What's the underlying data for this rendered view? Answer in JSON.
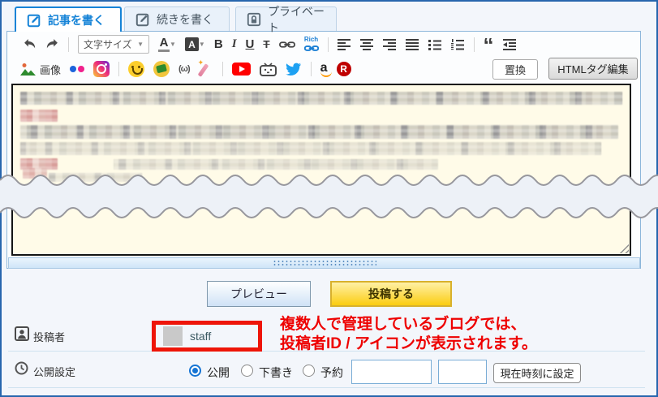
{
  "tabs": [
    {
      "label": "記事を書く",
      "active": true
    },
    {
      "label": "続きを書く",
      "active": false
    },
    {
      "label": "プライベート",
      "active": false
    }
  ],
  "toolbar": {
    "font_size": "文字サイズ",
    "font_color": "A",
    "bg_color": "A",
    "bold": "B",
    "italic": "I",
    "underline": "U",
    "strike": "T",
    "rich": "Rich",
    "quote": "“",
    "image": "画像",
    "kaomoji": "(ω)",
    "amazon": "a",
    "rakuten": "R",
    "replace": "置換",
    "html_edit": "HTMLタグ編集"
  },
  "actions": {
    "preview": "プレビュー",
    "submit": "投稿する"
  },
  "poster": {
    "label": "投稿者",
    "value": "staff"
  },
  "annotation": {
    "line1": "複数人で管理しているブログでは、",
    "line2": "投稿者ID / アイコンが表示されます。"
  },
  "publish": {
    "label": "公開設定",
    "options": [
      {
        "label": "公開",
        "selected": true
      },
      {
        "label": "下書き",
        "selected": false
      },
      {
        "label": "予約",
        "selected": false
      }
    ],
    "date_value": "",
    "time_value": "",
    "now_button": "現在時刻に設定"
  },
  "colors": {
    "accent_blue": "#1583d7",
    "frame_blue": "#2766ad",
    "annotation_red": "#ee0000",
    "submit_yellow": "#fccf1b",
    "editor_cream": "#fffbe8"
  }
}
